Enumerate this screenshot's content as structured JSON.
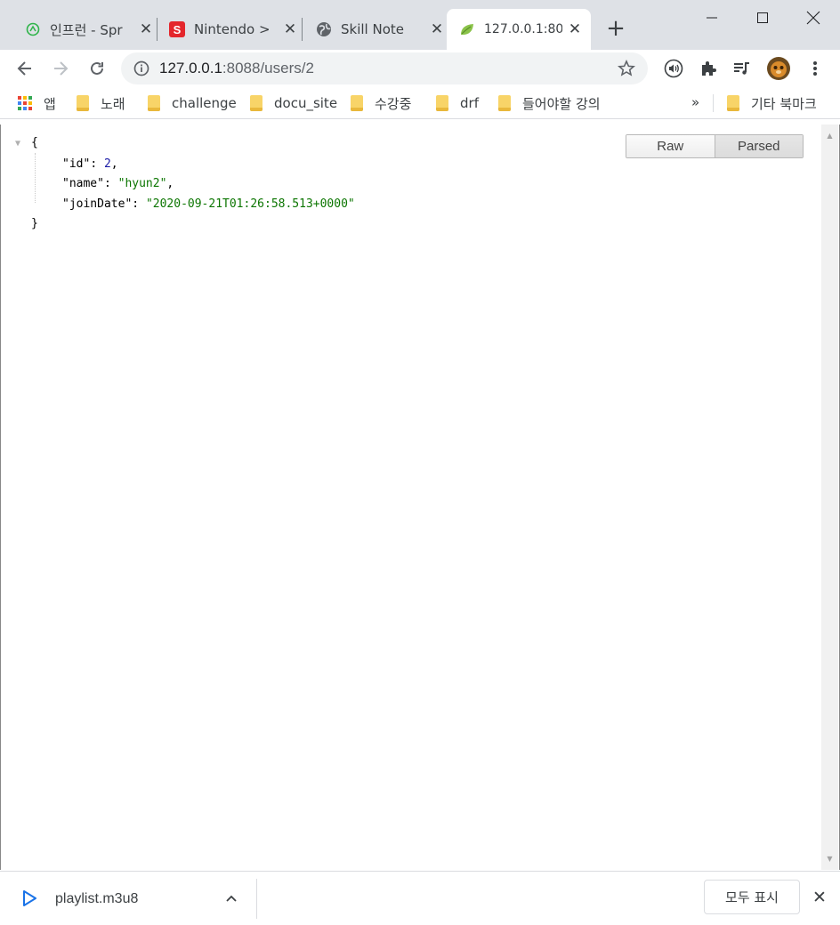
{
  "tabs": [
    {
      "title": "인프런 - Spr",
      "icon": "inflearn-icon",
      "active": false
    },
    {
      "title": "Nintendo >",
      "icon": "nintendo-s-icon",
      "active": false
    },
    {
      "title": "Skill Note",
      "icon": "globe-icon",
      "active": false
    },
    {
      "title": "127.0.0.1:80",
      "icon": "spring-leaf-icon",
      "active": true
    }
  ],
  "nintendo_letter": "S",
  "toolbar": {
    "url_host": "127.0.0.1",
    "url_rest": ":8088/users/2"
  },
  "bookmarks": {
    "apps_label": "앱",
    "items": [
      "노래",
      "challenge",
      "docu_site",
      "수강중",
      "drf",
      "들어야할 강의"
    ],
    "more": "»",
    "other": "기타 북마크"
  },
  "json_view": {
    "open_brace": "{",
    "close_brace": "}",
    "fields": [
      {
        "key": "\"id\"",
        "colon": ": ",
        "value": "2",
        "comma": ","
      },
      {
        "key": "\"name\"",
        "colon": ": ",
        "value": "\"hyun2\"",
        "comma": ","
      },
      {
        "key": "\"joinDate\"",
        "colon": ": ",
        "value": "\"2020-09-21T01:26:58.513+0000\"",
        "comma": ""
      }
    ],
    "raw_label": "Raw",
    "parsed_label": "Parsed"
  },
  "downloads": {
    "file_name": "playlist.m3u8",
    "show_all": "모두 표시"
  },
  "colors": {
    "tab_strip": "#dee1e6",
    "json_string": "#0b7500",
    "json_number": "#1a1aa6",
    "omnibox_bg": "#f1f3f4"
  }
}
